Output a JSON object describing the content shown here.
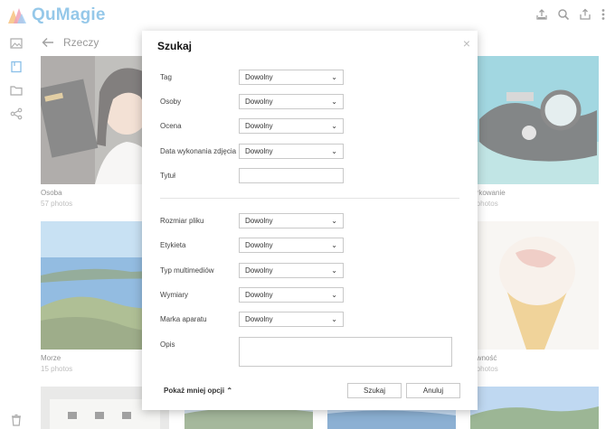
{
  "app": {
    "name": "QuMagie"
  },
  "header": {
    "icons": [
      "upload-tray-icon",
      "search-icon",
      "share-icon",
      "more-vertical-icon"
    ]
  },
  "sidebar": {
    "items": [
      "photos-icon",
      "things-icon",
      "folder-icon",
      "share-network-icon"
    ],
    "bottom": "trash-icon"
  },
  "main": {
    "title": "Rzeczy",
    "cards": [
      {
        "caption": "Osoba",
        "count": "57 photos"
      },
      {
        "caption": "...rkowanie",
        "count": "...photos"
      },
      {
        "caption": "Morze",
        "count": "15 photos"
      },
      {
        "caption": "...wność",
        "count": "...photos"
      }
    ]
  },
  "dialog": {
    "title": "Szukaj",
    "close": "×",
    "fields": {
      "tag": {
        "label": "Tag",
        "value": "Dowolny"
      },
      "people": {
        "label": "Osoby",
        "value": "Dowolny"
      },
      "rating": {
        "label": "Ocena",
        "value": "Dowolny"
      },
      "date_taken": {
        "label": "Data wykonania zdjęcia",
        "value": "Dowolny"
      },
      "title": {
        "label": "Tytuł",
        "value": ""
      },
      "file_size": {
        "label": "Rozmiar pliku",
        "value": "Dowolny"
      },
      "label": {
        "label": "Etykieta",
        "value": "Dowolny"
      },
      "media_type": {
        "label": "Typ multimediów",
        "value": "Dowolny"
      },
      "dimensions": {
        "label": "Wymiary",
        "value": "Dowolny"
      },
      "camera_make": {
        "label": "Marka aparatu",
        "value": "Dowolny"
      },
      "description": {
        "label": "Opis",
        "value": ""
      }
    },
    "show_less": "Pokaż mniej opcji",
    "search_button": "Szukaj",
    "cancel_button": "Anuluj"
  },
  "colors": {
    "brand": "#3f9bd8",
    "accent_active": "#2a8ad6"
  }
}
